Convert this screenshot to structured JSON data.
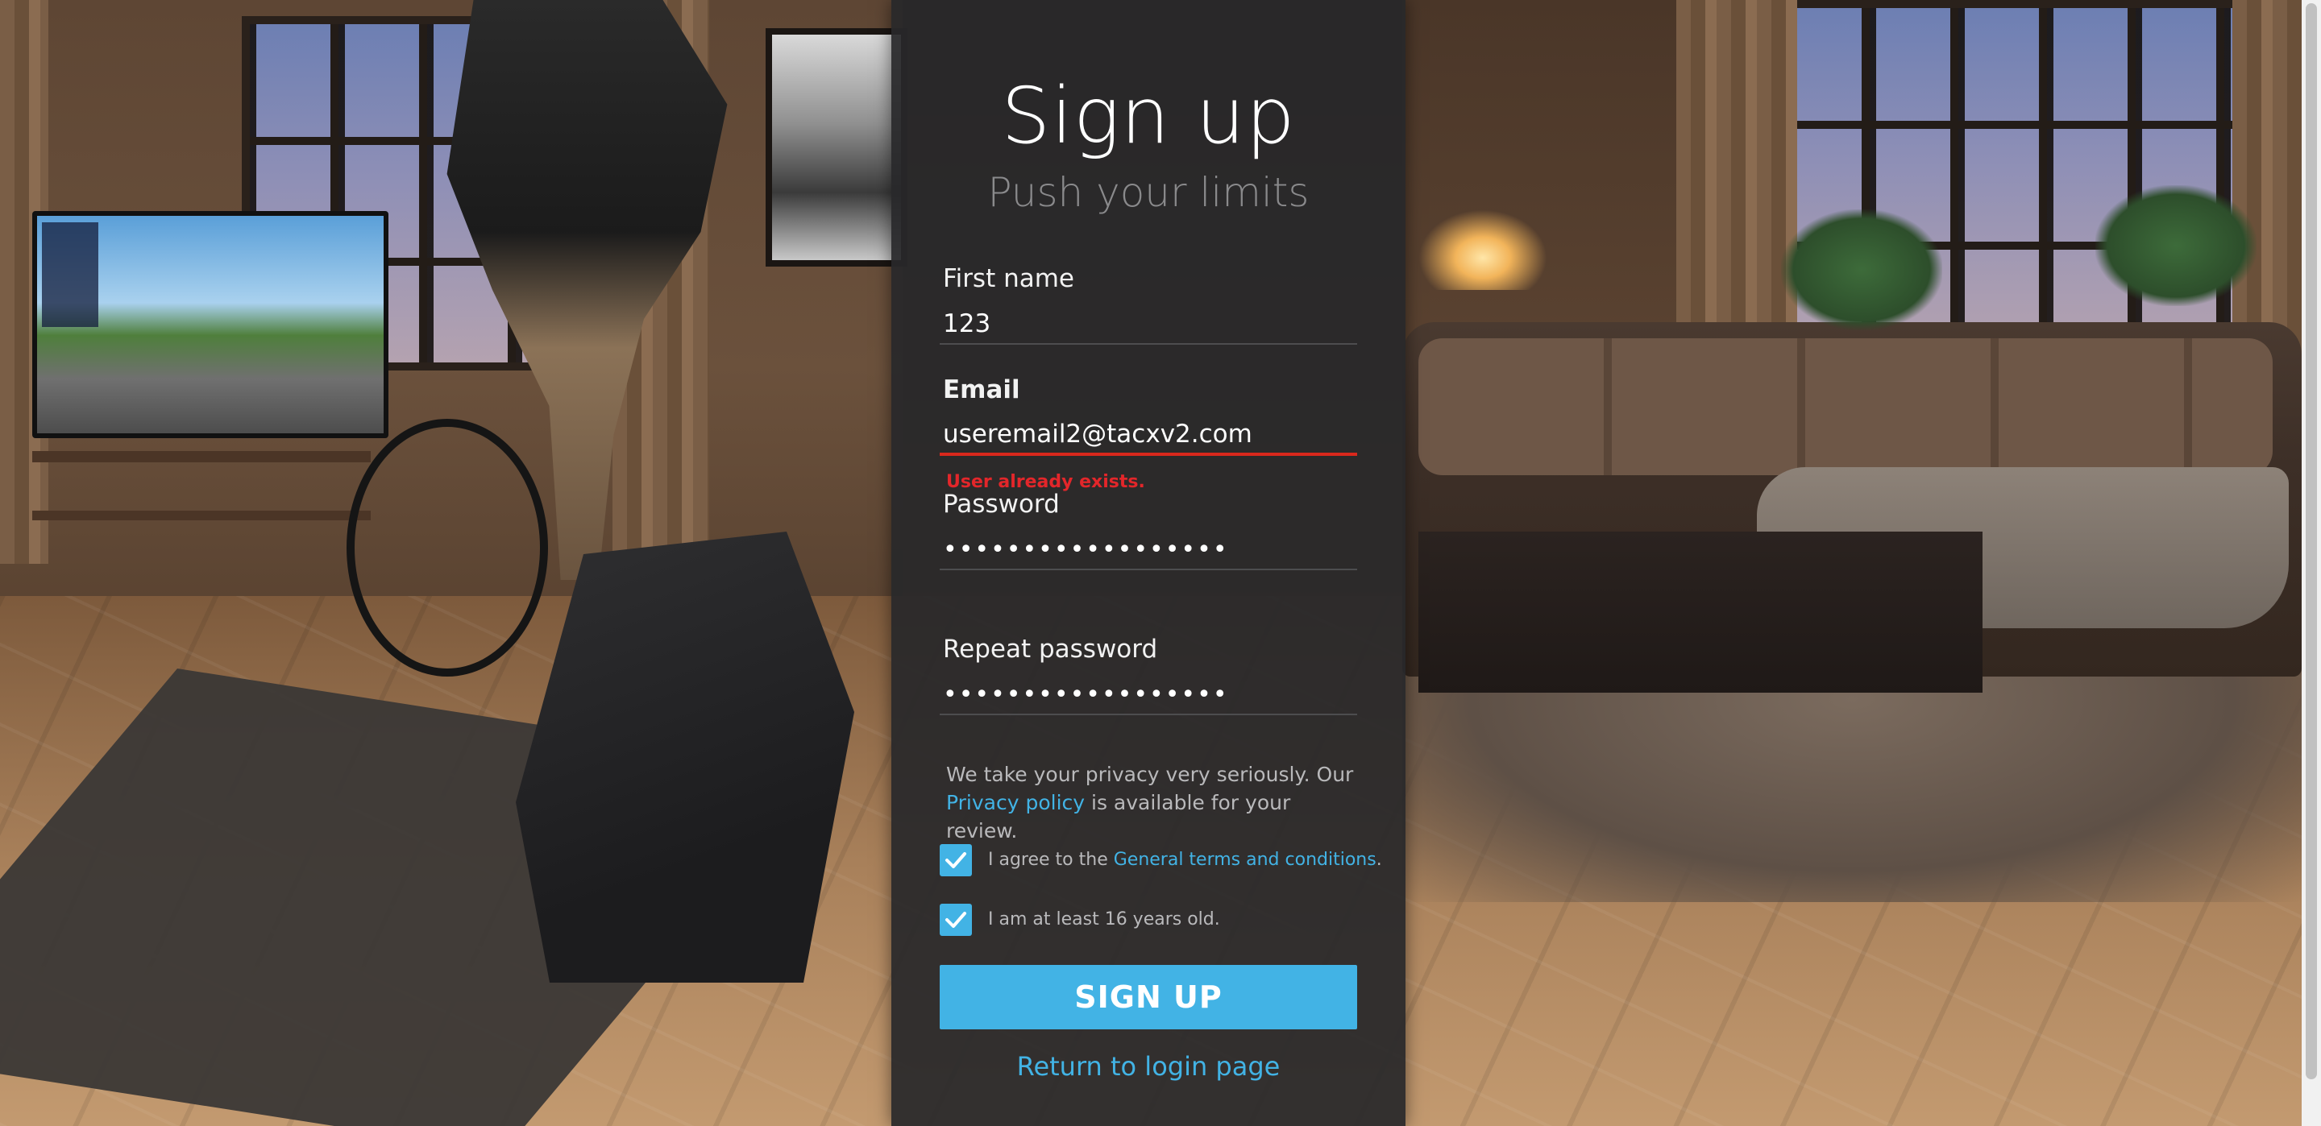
{
  "signup": {
    "title": "Sign up",
    "subtitle": "Push your limits",
    "first_name": {
      "label": "First name",
      "value": "123"
    },
    "email": {
      "label": "Email",
      "value": "useremail2@tacxv2.com",
      "error": "User already exists."
    },
    "password": {
      "label": "Password",
      "value": "••••••••••••••••••"
    },
    "repeat_password": {
      "label": "Repeat password",
      "value": "••••••••••••••••••"
    },
    "privacy": {
      "text_before": "We take your privacy very seriously. Our",
      "link": "Privacy policy",
      "text_after": " is available for your review."
    },
    "terms": {
      "text_before": "I agree to the ",
      "link": "General terms and conditions",
      "text_after": ".",
      "checked": true
    },
    "age": {
      "text": "I am at least 16 years old.",
      "checked": true
    },
    "submit_label": "SIGN UP",
    "return_link": "Return to login page"
  },
  "colors": {
    "accent": "#42b3e5",
    "error": "#e3262a",
    "panel_background": "#28282a"
  },
  "icons": {
    "checkbox": "checkmark-icon"
  }
}
